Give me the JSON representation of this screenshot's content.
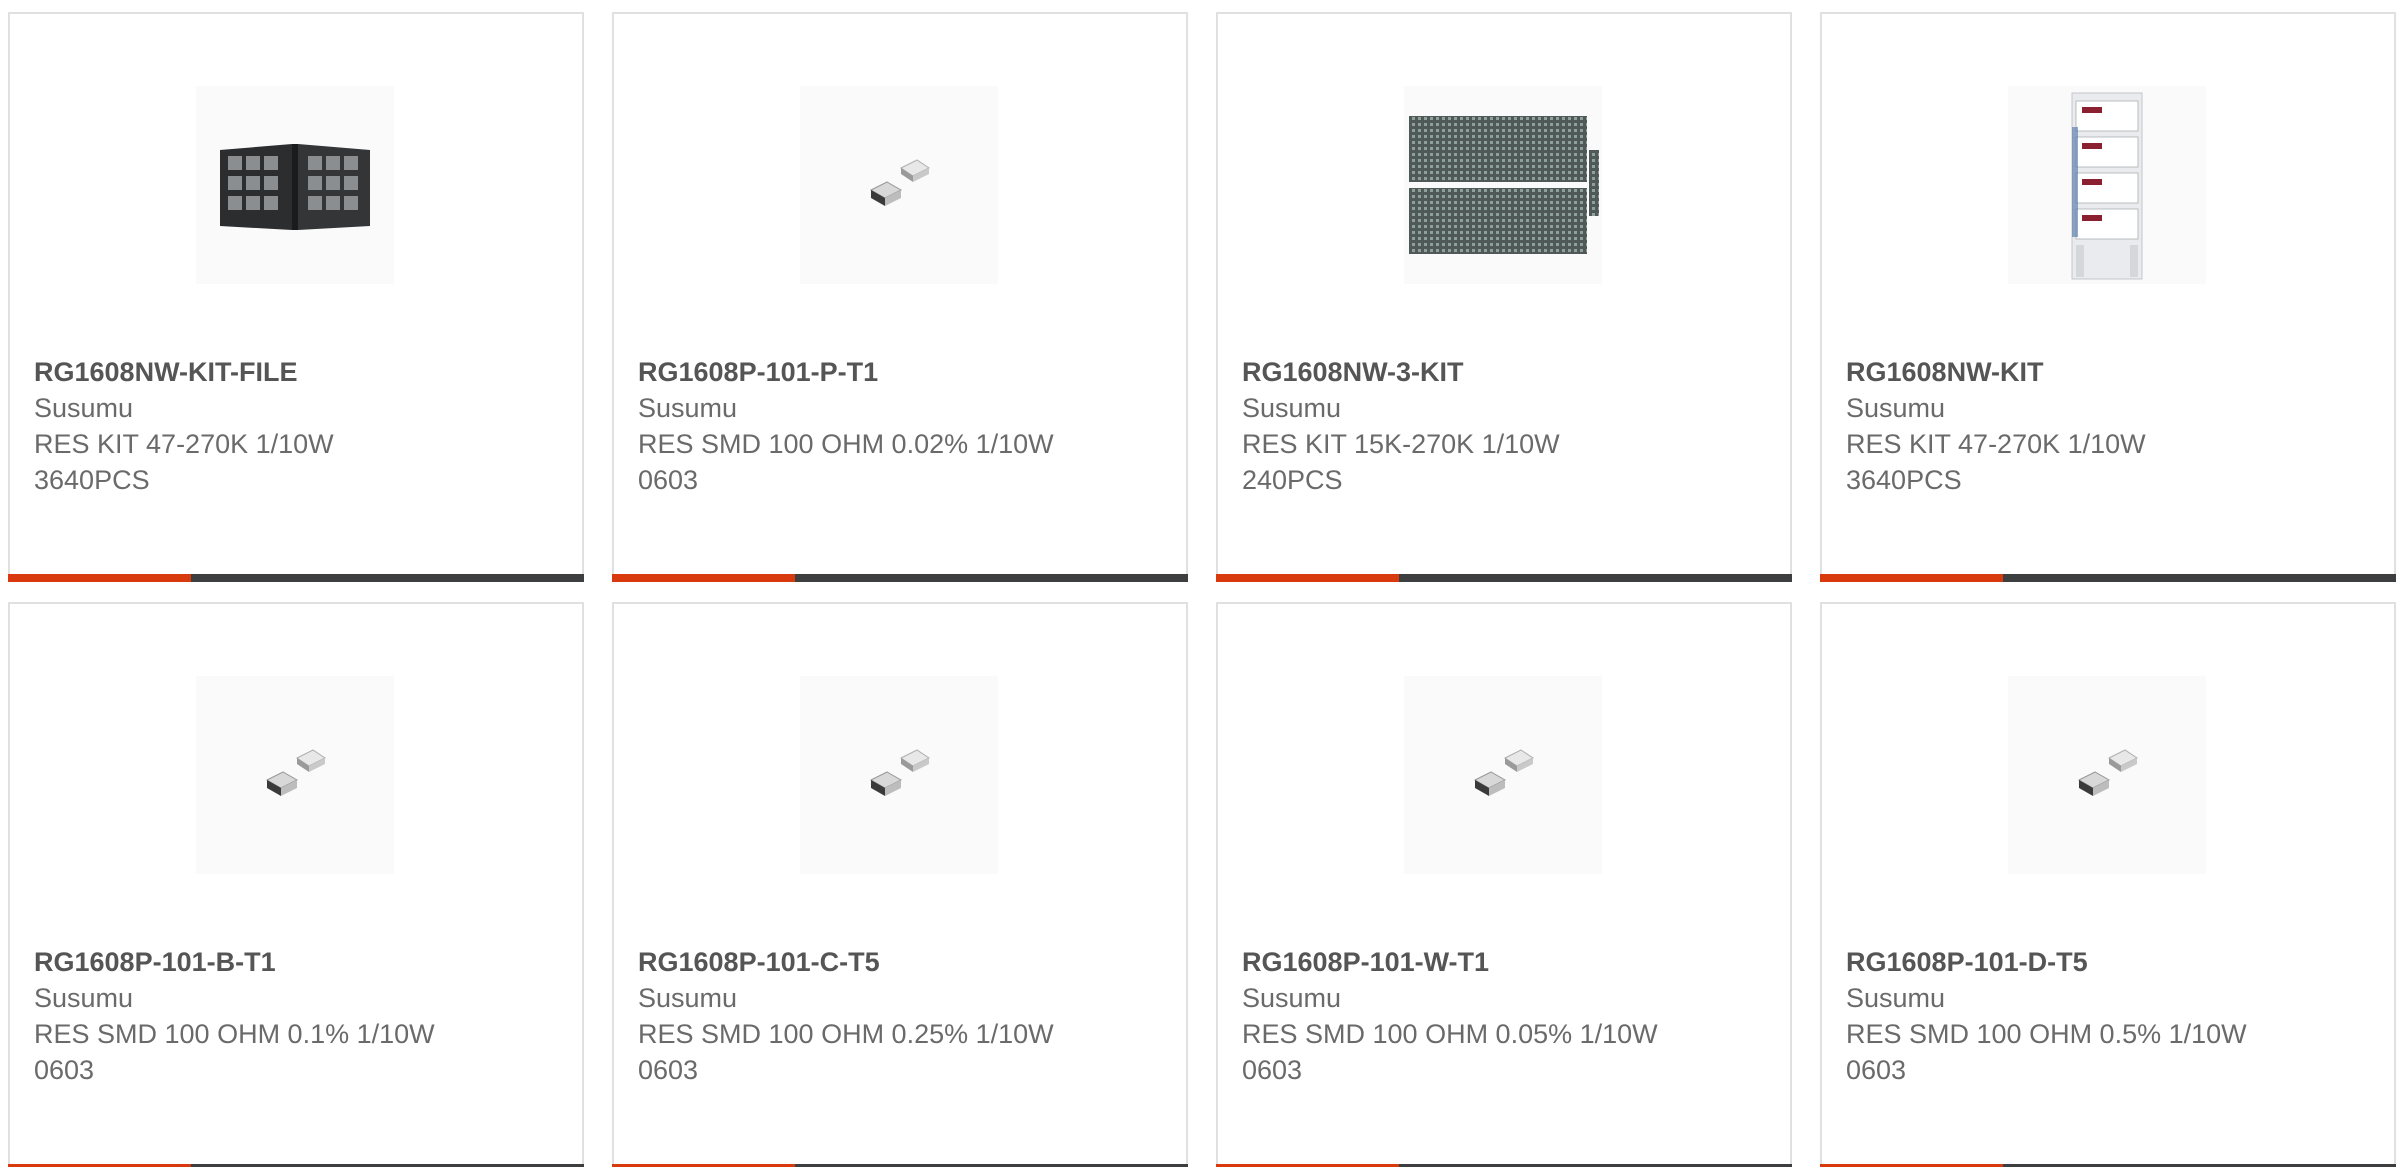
{
  "colors": {
    "accent": "#d83a0d",
    "bar_dark": "#3c3e40",
    "border": "#e0e0e0",
    "text": "#6a6a6a"
  },
  "products": [
    {
      "part_number": "RG1608NW-KIT-FILE",
      "manufacturer": "Susumu",
      "description": "RES KIT 47-270K 1/10W 3640PCS",
      "image": "binder-kit-image"
    },
    {
      "part_number": "RG1608P-101-P-T1",
      "manufacturer": "Susumu",
      "description": "RES SMD 100 OHM 0.02% 1/10W 0603",
      "image": "smd-resistor-image"
    },
    {
      "part_number": "RG1608NW-3-KIT",
      "manufacturer": "Susumu",
      "description": "RES KIT 15K-270K 1/10W 240PCS",
      "image": "tape-strip-kit-image"
    },
    {
      "part_number": "RG1608NW-KIT",
      "manufacturer": "Susumu",
      "description": "RES KIT 47-270K 1/10W 3640PCS",
      "image": "drawer-kit-image"
    },
    {
      "part_number": "RG1608P-101-B-T1",
      "manufacturer": "Susumu",
      "description": "RES SMD 100 OHM 0.1% 1/10W 0603",
      "image": "smd-resistor-image"
    },
    {
      "part_number": "RG1608P-101-C-T5",
      "manufacturer": "Susumu",
      "description": "RES SMD 100 OHM 0.25% 1/10W 0603",
      "image": "smd-resistor-image"
    },
    {
      "part_number": "RG1608P-101-W-T1",
      "manufacturer": "Susumu",
      "description": "RES SMD 100 OHM 0.05% 1/10W 0603",
      "image": "smd-resistor-image"
    },
    {
      "part_number": "RG1608P-101-D-T5",
      "manufacturer": "Susumu",
      "description": "RES SMD 100 OHM 0.5% 1/10W 0603",
      "image": "smd-resistor-image"
    }
  ]
}
